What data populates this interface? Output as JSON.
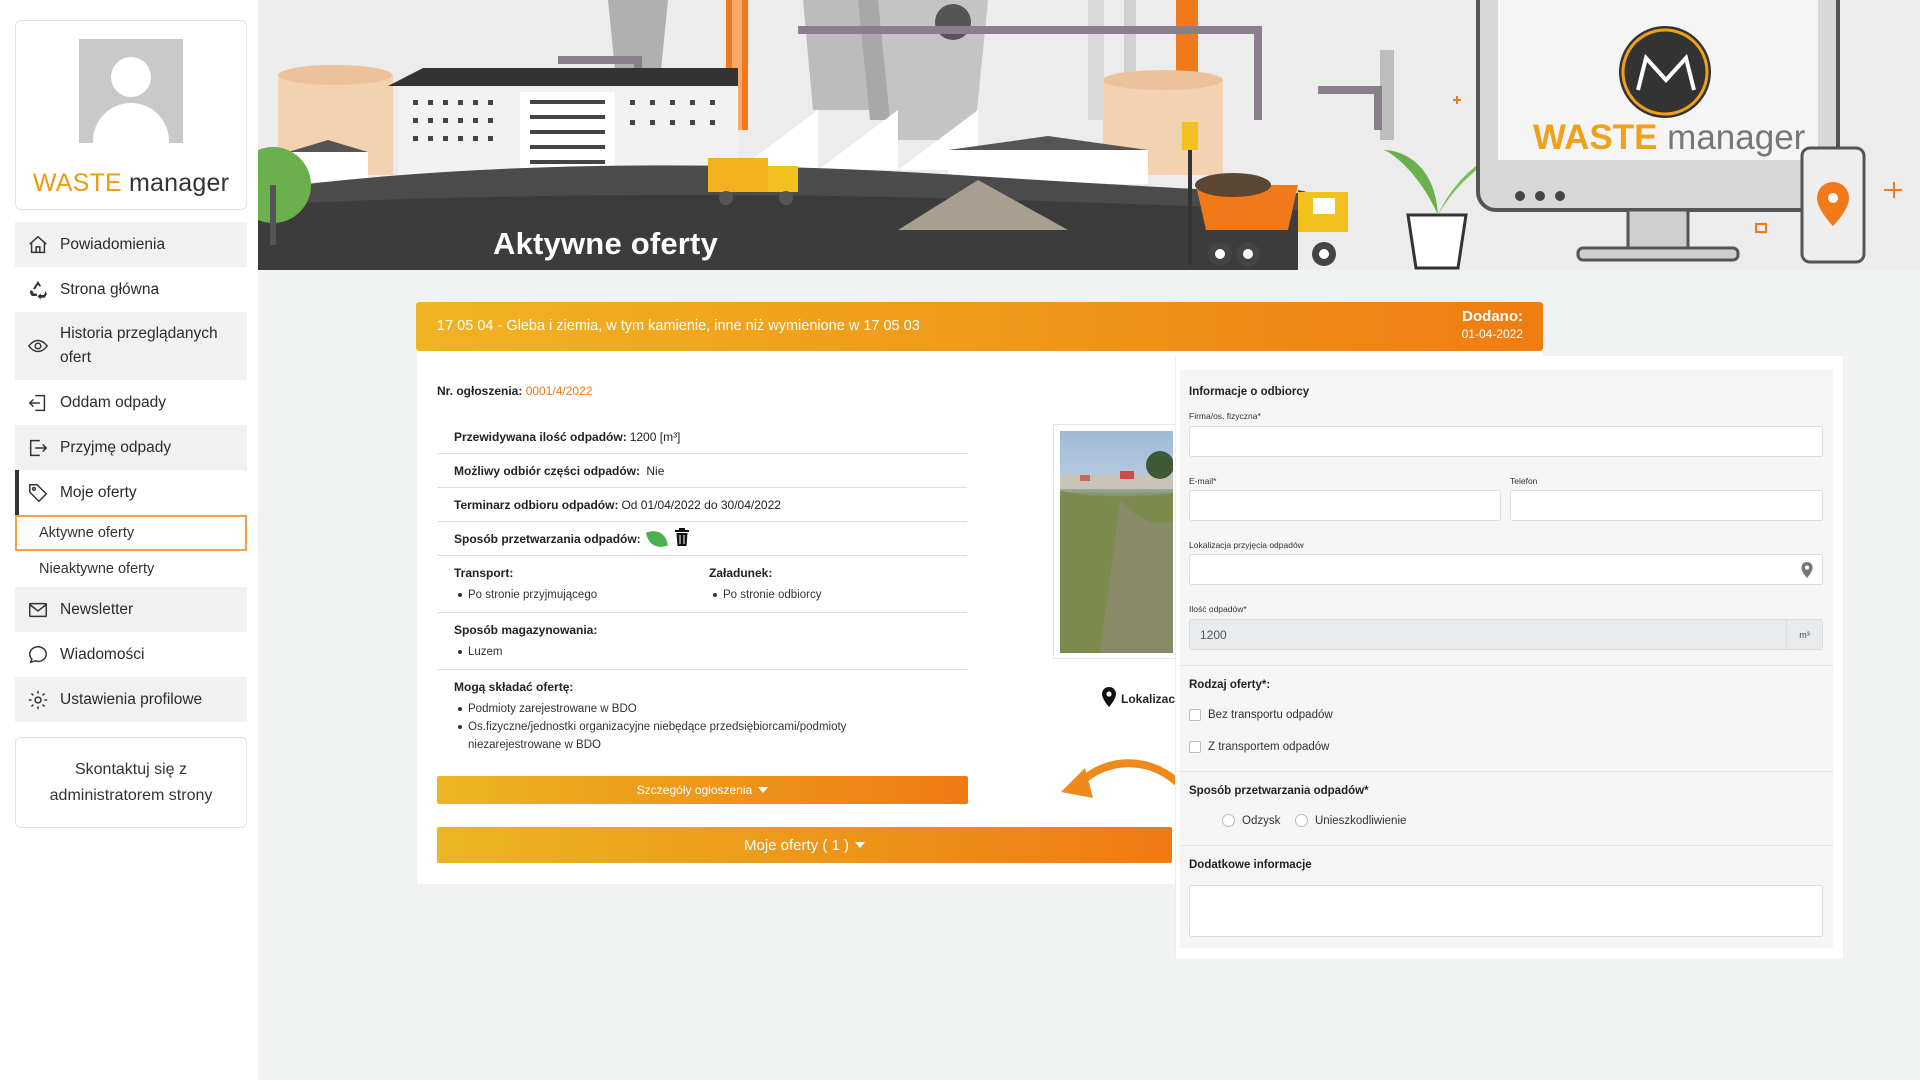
{
  "brand": {
    "accent": "WASTE",
    "rest": " manager"
  },
  "sidebar": {
    "items": [
      {
        "label": "Powiadomienia",
        "icon": "home-icon"
      },
      {
        "label": "Strona główna",
        "icon": "recycle-icon"
      },
      {
        "label": "Historia przeglądanych ofert",
        "icon": "eye-icon"
      },
      {
        "label": "Oddam odpady",
        "icon": "login-icon"
      },
      {
        "label": "Przyjmę odpady",
        "icon": "logout-icon"
      },
      {
        "label": "Moje oferty",
        "icon": "tag-icon"
      },
      {
        "label": "Aktywne oferty"
      },
      {
        "label": "Nieaktywne oferty"
      },
      {
        "label": "Newsletter",
        "icon": "mail-icon"
      },
      {
        "label": "Wiadomości",
        "icon": "chat-icon"
      },
      {
        "label": "Ustawienia profilowe",
        "icon": "gear-icon"
      }
    ],
    "contact": "Skontaktuj się z administratorem strony"
  },
  "banner": {
    "title": "Aktywne oferty",
    "brand_accent": "WASTE",
    "brand_rest": " manager"
  },
  "offer": {
    "title": "17 05 04 - Gleba i ziemia, w tym kamienie, inne niż wymienione w 17 05 03",
    "added_label": "Dodano:",
    "added_date": "01-04-2022",
    "number_label": "Nr. ogłoszenia:",
    "number": "0001/4/2022",
    "quantity_label": "Przewidywana ilość odpadów:",
    "quantity": "1200 [m³]",
    "partial_label": "Możliwy odbiór części odpadów:",
    "partial": "Nie",
    "term_label": "Terminarz odbioru odpadów:",
    "term": "Od 01/04/2022 do 30/04/2022",
    "processing_label": "Sposób przetwarzania odpadów:",
    "transport_label": "Transport:",
    "transport": [
      "Po stronie przyjmującego"
    ],
    "loading_label": "Załadunek:",
    "loading": [
      "Po stronie odbiorcy"
    ],
    "storage_label": "Sposób magazynowania:",
    "storage": [
      "Luzem"
    ],
    "who_label": "Mogą składać ofertę:",
    "who": [
      "Podmioty zarejestrowane w BDO",
      "Os.fizyczne/jednostki organizacyjne niebędące przedsiębiorcami/podmioty niezarejestrowane w BDO"
    ],
    "details_button": "Szczegóły ogłoszenia",
    "my_offers_button": "Moje oferty ( 1 )",
    "location_label": "Lokalizac"
  },
  "receiver": {
    "title": "Informacje o odbiorcy",
    "company_label": "Firma/os. fizyczna*",
    "email_label": "E-mail*",
    "phone_label": "Telefon",
    "location_label": "Lokalizacja przyjęcia odpadów",
    "quantity_label": "Ilość odpadów*",
    "quantity_value": "1200",
    "quantity_unit": "m³",
    "offer_type_label": "Rodzaj oferty*:",
    "offer_types": [
      "Bez transportu odpadów",
      "Z transportem odpadów"
    ],
    "processing_label": "Sposób przetwarzania odpadów*",
    "processing_options": [
      "Odzysk",
      "Unieszkodliwienie"
    ],
    "additional_label": "Dodatkowe informacje"
  },
  "colors": {
    "accent": "#f09a10",
    "gradient_start": "#f0b422",
    "gradient_end": "#ef7d12"
  }
}
